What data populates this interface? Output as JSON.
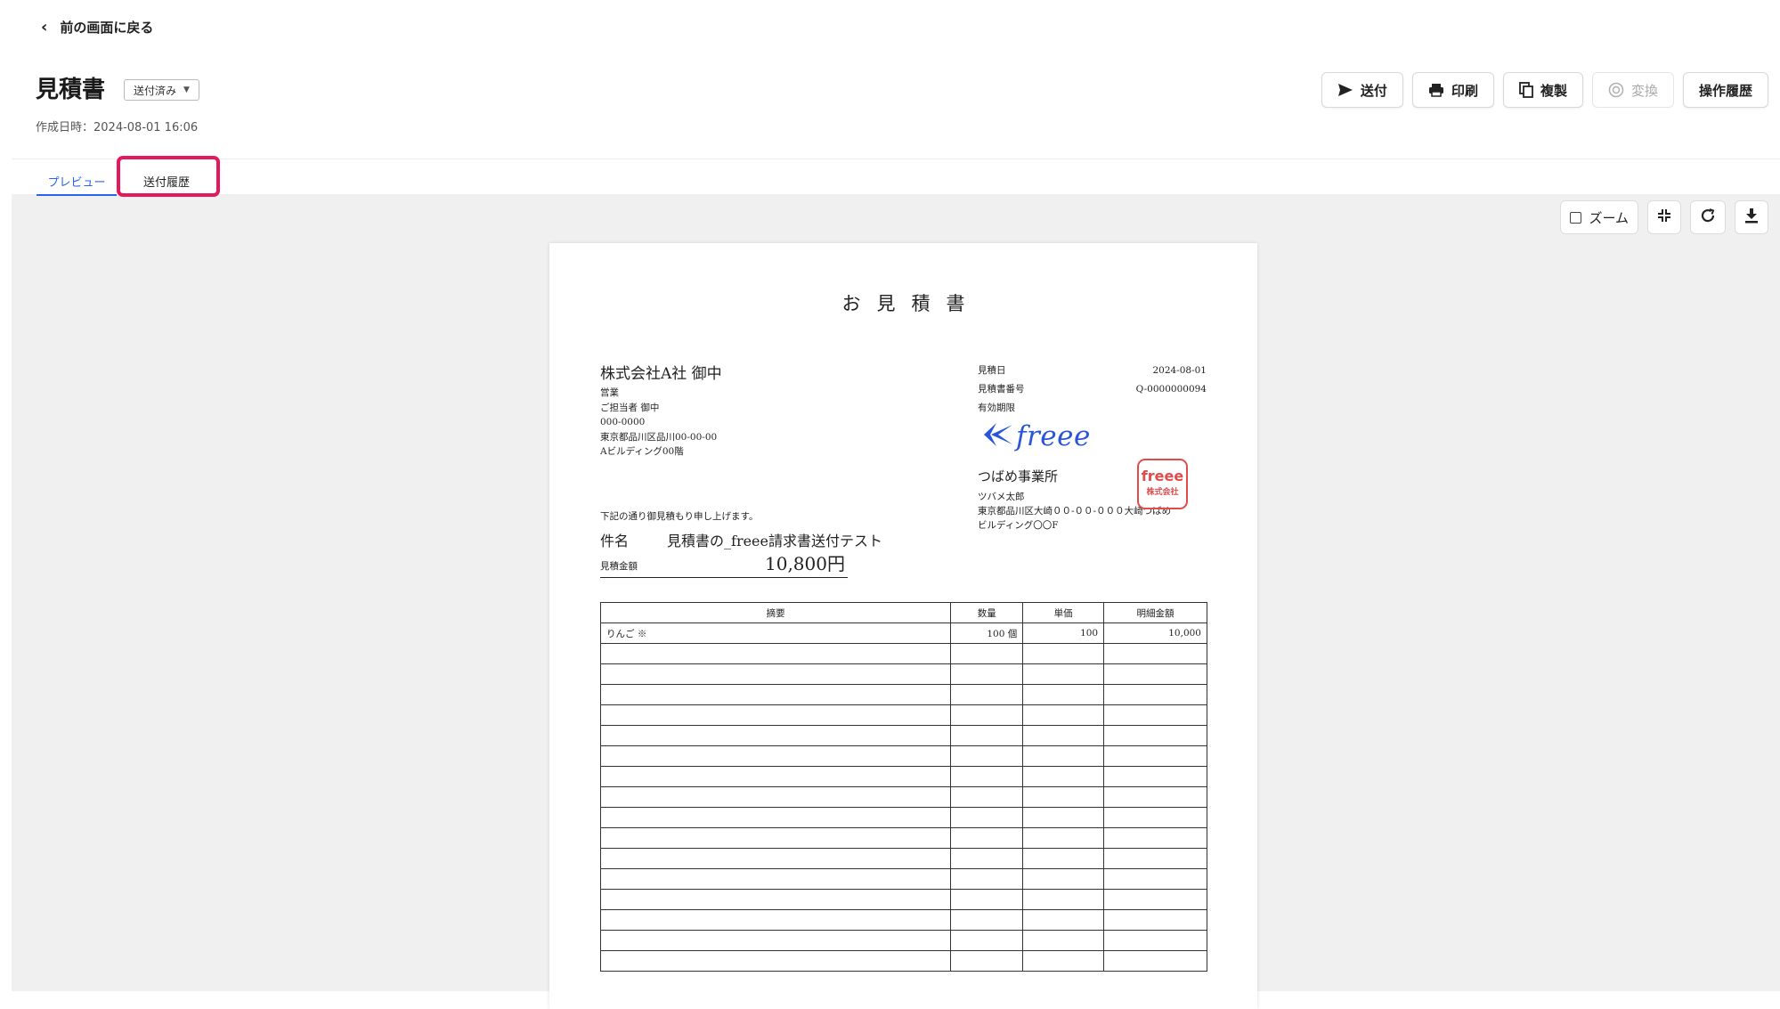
{
  "nav": {
    "back_label": "前の画面に戻る"
  },
  "header": {
    "title": "見積書",
    "status": "送付済み",
    "created_at": "作成日時：2024-08-01 16:06"
  },
  "actions": {
    "send": "送付",
    "print": "印刷",
    "duplicate": "複製",
    "convert": "変換",
    "history": "操作履歴"
  },
  "tabs": {
    "preview": "プレビュー",
    "send_history": "送付履歴"
  },
  "viewer_tools": {
    "zoom_label": "ズーム"
  },
  "document": {
    "title": "お見積書",
    "client": {
      "name": "株式会社A社 御中",
      "lines": [
        "営業",
        "ご担当者 御中",
        "000-0000",
        "東京都品川区品川00-00-00",
        "Aビルディング00階"
      ]
    },
    "meta": [
      {
        "label": "見積日",
        "value": "2024-08-01"
      },
      {
        "label": "見積書番号",
        "value": "Q-0000000094"
      },
      {
        "label": "有効期限",
        "value": ""
      }
    ],
    "logo_text": "freee",
    "issuer": {
      "name": "つばめ事業所",
      "lines": [
        "ツバメ太郎",
        "東京都品川区大崎００-００-０００大崎つばめ",
        "ビルディング〇〇F"
      ]
    },
    "stamp": {
      "top": "freee",
      "bottom": "株式会社"
    },
    "intro": "下記の通り御見積もり申し上げます。",
    "subject_label": "件名",
    "subject_value": "見積書の_freee請求書送付テスト",
    "amount_label": "見積金額",
    "amount_value": "10,800円",
    "table": {
      "headers": [
        "摘要",
        "数量",
        "単価",
        "明細金額"
      ],
      "rows": [
        [
          "りんご ※",
          "100 個",
          "100",
          "10,000"
        ],
        [
          "",
          "",
          "",
          ""
        ],
        [
          "",
          "",
          "",
          ""
        ],
        [
          "",
          "",
          "",
          ""
        ],
        [
          "",
          "",
          "",
          ""
        ],
        [
          "",
          "",
          "",
          ""
        ],
        [
          "",
          "",
          "",
          ""
        ],
        [
          "",
          "",
          "",
          ""
        ],
        [
          "",
          "",
          "",
          ""
        ],
        [
          "",
          "",
          "",
          ""
        ],
        [
          "",
          "",
          "",
          ""
        ],
        [
          "",
          "",
          "",
          ""
        ],
        [
          "",
          "",
          "",
          ""
        ],
        [
          "",
          "",
          "",
          ""
        ],
        [
          "",
          "",
          "",
          ""
        ],
        [
          "",
          "",
          "",
          ""
        ],
        [
          "",
          "",
          "",
          ""
        ]
      ]
    }
  },
  "colors": {
    "accent": "#2864f0",
    "highlight": "#e5175f",
    "stamp": "#e14b4b",
    "logo": "#2a55d6"
  }
}
